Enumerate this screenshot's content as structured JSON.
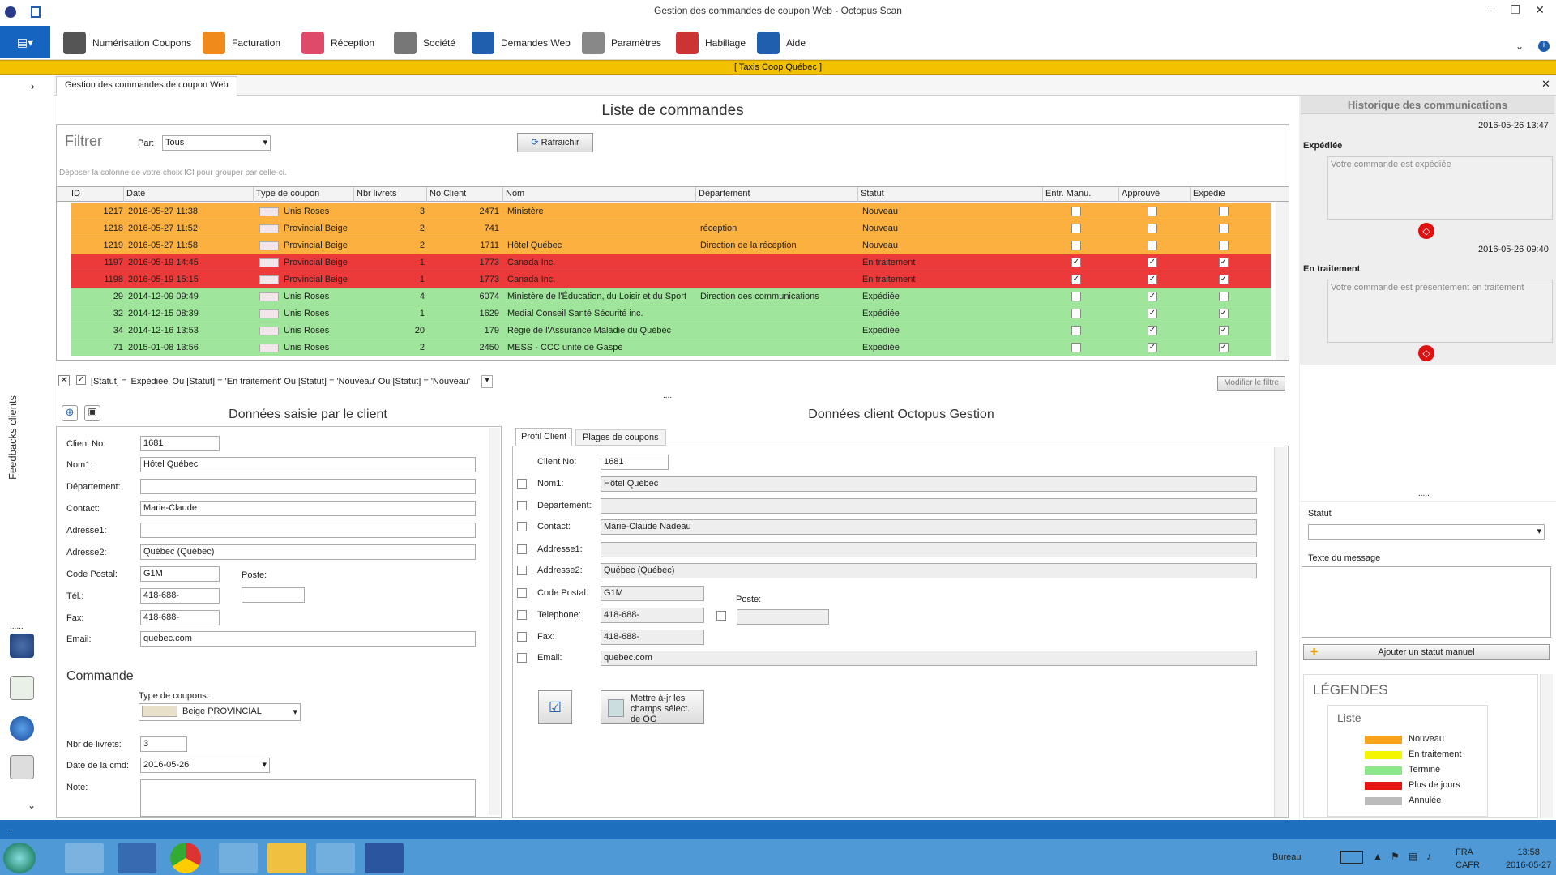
{
  "window": {
    "title": "Gestion des commandes de coupon Web - Octopus Scan",
    "min": "–",
    "max": "❐",
    "close": "✕"
  },
  "menu": [
    {
      "label": "Numérisation Coupons",
      "icon": "scanner-icon",
      "color": "#555"
    },
    {
      "label": "Facturation",
      "icon": "invoice-icon",
      "color": "#f08a1c"
    },
    {
      "label": "Réception",
      "icon": "home-icon",
      "color": "#e04a6a"
    },
    {
      "label": "Société",
      "icon": "building-icon",
      "color": "#777"
    },
    {
      "label": "Demandes Web",
      "icon": "globe-icon",
      "color": "#1f5fae"
    },
    {
      "label": "Paramètres",
      "icon": "tools-icon",
      "color": "#888"
    },
    {
      "label": "Habillage",
      "icon": "palette-icon",
      "color": "#c33"
    },
    {
      "label": "Aide",
      "icon": "help-icon",
      "color": "#1f5fae"
    }
  ],
  "company": "[  Taxis Coop Québec  ]",
  "left": {
    "vertical": "Feedbacks clients"
  },
  "tab": "Gestion des commandes de coupon Web",
  "list": {
    "title": "Liste de commandes",
    "filter_label": "Filtrer",
    "par_label": "Par:",
    "par_value": "Tous",
    "refresh": "Rafraichir",
    "group_hint": "Déposer la colonne de votre choix ICI pour grouper par celle-ci.",
    "columns": [
      "ID",
      "Date",
      "Type de coupon",
      "Nbr livrets",
      "No Client",
      "Nom",
      "Département",
      "Statut",
      "Entr. Manu.",
      "Approuvé",
      "Expédié"
    ],
    "rows": [
      {
        "id": "1217",
        "date": "2016-05-27 11:38",
        "type": "Unis Roses",
        "nbr": "3",
        "client": "2471",
        "nom": "Ministère",
        "dept": "",
        "statut": "Nouveau",
        "manu": false,
        "appr": false,
        "exp": false,
        "color": "#fbb040"
      },
      {
        "id": "1218",
        "date": "2016-05-27 11:52",
        "type": "Provincial Beige",
        "nbr": "2",
        "client": "741",
        "nom": "",
        "dept": "réception",
        "statut": "Nouveau",
        "manu": false,
        "appr": false,
        "exp": false,
        "color": "#fbb040"
      },
      {
        "id": "1219",
        "date": "2016-05-27 11:58",
        "type": "Provincial Beige",
        "nbr": "2",
        "client": "1711",
        "nom": "Hôtel Québec",
        "dept": "Direction de la réception",
        "statut": "Nouveau",
        "manu": false,
        "appr": false,
        "exp": false,
        "color": "#fbb040"
      },
      {
        "id": "1197",
        "date": "2016-05-19 14:45",
        "type": "Provincial Beige",
        "nbr": "1",
        "client": "1773",
        "nom": "Canada Inc.",
        "dept": "",
        "statut": "En traitement",
        "manu": true,
        "appr": true,
        "exp": true,
        "color": "#ec3a3a"
      },
      {
        "id": "1198",
        "date": "2016-05-19 15:15",
        "type": "Provincial Beige",
        "nbr": "1",
        "client": "1773",
        "nom": "Canada Inc.",
        "dept": "",
        "statut": "En traitement",
        "manu": true,
        "appr": true,
        "exp": true,
        "color": "#ec3a3a"
      },
      {
        "id": "29",
        "date": "2014-12-09 09:49",
        "type": "Unis Roses",
        "nbr": "4",
        "client": "6074",
        "nom": "Ministère de l'Éducation, du Loisir et du Sport",
        "dept": "Direction des communications",
        "statut": "Expédiée",
        "manu": false,
        "appr": true,
        "exp": false,
        "color": "#9fe69c"
      },
      {
        "id": "32",
        "date": "2014-12-15 08:39",
        "type": "Unis Roses",
        "nbr": "1",
        "client": "1629",
        "nom": "Medial Conseil Santé Sécurité inc.",
        "dept": "",
        "statut": "Expédiée",
        "manu": false,
        "appr": true,
        "exp": true,
        "color": "#9fe69c"
      },
      {
        "id": "34",
        "date": "2014-12-16 13:53",
        "type": "Unis Roses",
        "nbr": "20",
        "client": "179",
        "nom": "Régie de l'Assurance Maladie du Québec",
        "dept": "",
        "statut": "Expédiée",
        "manu": false,
        "appr": true,
        "exp": true,
        "color": "#9fe69c"
      },
      {
        "id": "71",
        "date": "2015-01-08 13:56",
        "type": "Unis Roses",
        "nbr": "2",
        "client": "2450",
        "nom": "MESS - CCC unité de Gaspé",
        "dept": "",
        "statut": "Expédiée",
        "manu": false,
        "appr": true,
        "exp": true,
        "color": "#9fe69c"
      }
    ],
    "filter_expr": "[Statut] = 'Expédiée' Ou [Statut] = 'En traitement' Ou [Statut] = 'Nouveau' Ou [Statut] = 'Nouveau'",
    "modify_filter": "Modifier le filtre"
  },
  "client": {
    "title": "Données saisie par le client",
    "fields": [
      {
        "label": "Client No:",
        "value": "1681"
      },
      {
        "label": "Nom1:",
        "value": "Hôtel Québec"
      },
      {
        "label": "Département:",
        "value": ""
      },
      {
        "label": "Contact:",
        "value": "Marie-Claude"
      },
      {
        "label": "Adresse1:",
        "value": ""
      },
      {
        "label": "Adresse2:",
        "value": "Québec (Québec)"
      },
      {
        "label": "Code Postal:",
        "value": "G1M"
      },
      {
        "label": "Tél.:",
        "value": "418-688-"
      },
      {
        "label": "Fax:",
        "value": "418-688-"
      },
      {
        "label": "Email:",
        "value": "quebec.com"
      }
    ],
    "poste": "Poste:",
    "commande": "Commande",
    "type_label": "Type de coupons:",
    "type_value": "Beige PROVINCIAL",
    "nbr_label": "Nbr de livrets:",
    "nbr_value": "3",
    "date_label": "Date de la cmd:",
    "date_value": "2016-05-26",
    "note_label": "Note:"
  },
  "og": {
    "title": "Données client Octopus Gestion",
    "tabs": [
      "Profil Client",
      "Plages de coupons"
    ],
    "fields": [
      {
        "label": "Client No:",
        "value": "1681"
      },
      {
        "label": "Nom1:",
        "value": "Hôtel Québec"
      },
      {
        "label": "Département:",
        "value": ""
      },
      {
        "label": "Contact:",
        "value": "Marie-Claude Nadeau"
      },
      {
        "label": "Addresse1:",
        "value": ""
      },
      {
        "label": "Addresse2:",
        "value": "Québec (Québec)"
      },
      {
        "label": "Code Postal:",
        "value": "G1M"
      },
      {
        "label": "Telephone:",
        "value": "418-688-"
      },
      {
        "label": "Fax:",
        "value": "418-688-"
      },
      {
        "label": "Email:",
        "value": "quebec.com"
      }
    ],
    "poste": "Poste:",
    "update": "Mettre à-jr les champs sélect. de OG"
  },
  "history": {
    "title": "Historique des communications",
    "entries": [
      {
        "date": "2016-05-26 13:47",
        "status": "Expédiée",
        "msg": "Votre commande est expédiée"
      },
      {
        "date": "2016-05-26 09:40",
        "status": "En traitement",
        "msg": "Votre commande est présentement en traitement"
      }
    ],
    "statut_label": "Statut",
    "texte_label": "Texte du message",
    "add": "Ajouter un statut manuel",
    "legend_title": "LÉGENDES",
    "legend_sub": "Liste",
    "legend": [
      {
        "label": "Nouveau",
        "color": "#f7a21a"
      },
      {
        "label": "En traitement",
        "color": "#f5f500"
      },
      {
        "label": "Terminé",
        "color": "#8fe68a"
      },
      {
        "label": "Plus de jours",
        "color": "#e81414"
      },
      {
        "label": "Annulée",
        "color": "#bbbbbb"
      }
    ]
  },
  "taskbar": {
    "bureau": "Bureau",
    "lang1": "FRA",
    "lang2": "CAFR",
    "time": "13:58",
    "date": "2016-05-27"
  }
}
